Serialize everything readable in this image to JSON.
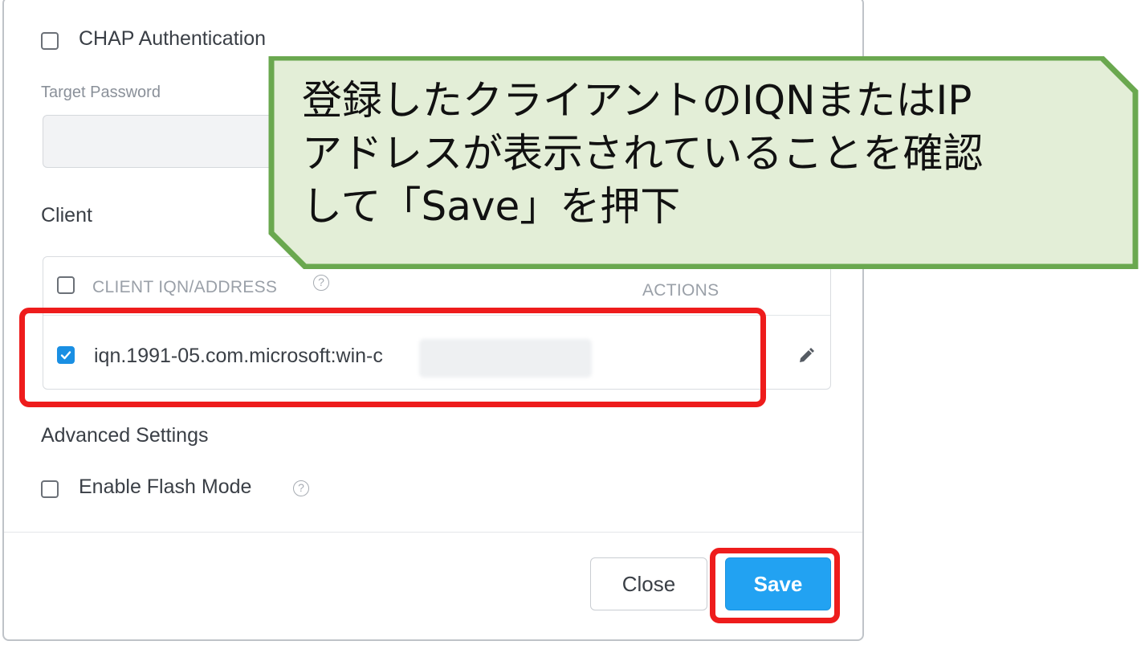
{
  "dialog": {
    "chap": {
      "label": "CHAP Authentication",
      "checked": false
    },
    "target_password": {
      "label": "Target Password",
      "value": ""
    },
    "client_section": "Client",
    "table": {
      "columns": [
        "CLIENT IQN/ADDRESS",
        "ACTIONS"
      ],
      "rows": [
        {
          "value": "iqn.1991-05.com.microsoft:win-c",
          "checked": true
        }
      ]
    },
    "advanced_section": "Advanced Settings",
    "flash_mode": {
      "label": "Enable Flash Mode",
      "checked": false
    },
    "buttons": {
      "close": "Close",
      "save": "Save"
    }
  },
  "callout": {
    "text": "登録したクライアントのIQNまたはIP\nアドレスが表示されていることを確認\nして「Save」を押下"
  },
  "colors": {
    "accent": "#22a2f2",
    "highlight": "#ee1c1c",
    "callout_fill": "#e3eed7",
    "callout_border": "#6aa84f"
  },
  "icons": [
    "checkbox-icon",
    "help-icon",
    "pencil-icon",
    "check-icon"
  ]
}
